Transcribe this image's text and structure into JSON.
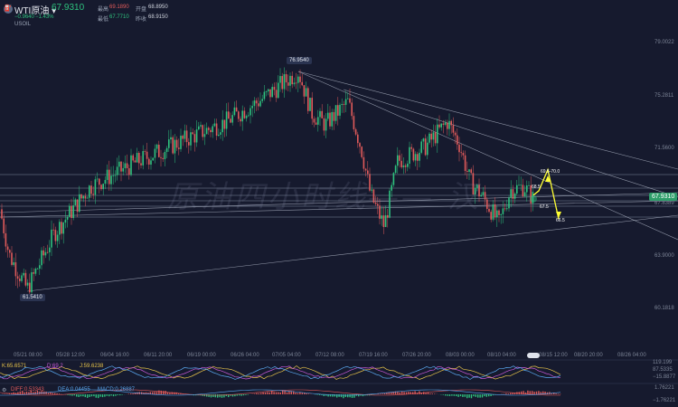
{
  "header": {
    "symbol": "WTI原油",
    "dropdown_glyph": "▾",
    "price": "67.9310",
    "change": "−0.9640",
    "change_pct": "−1.43%",
    "subtitle": "USOIL",
    "quotes": [
      {
        "label": "最高",
        "value": "69.1890",
        "color": "#e05a5a"
      },
      {
        "label": "开盘",
        "value": "68.8950",
        "color": "#cfd3dc"
      },
      {
        "label": "最低",
        "value": "67.7710",
        "color": "#2ec27e"
      },
      {
        "label": "昨收",
        "value": "68.9150",
        "color": "#cfd3dc"
      }
    ],
    "icon": "oil-icon"
  },
  "y_axis": [
    "79.0022",
    "75.2811",
    "71.5600",
    "67.8389",
    "63.9000",
    "60.1818"
  ],
  "x_axis": [
    "05/21 08:00",
    "05/28 12:00",
    "06/04 16:00",
    "06/11 20:00",
    "06/19 00:00",
    "06/26 04:00",
    "07/05 04:00",
    "07/12 08:00",
    "07/19 16:00",
    "07/26 20:00",
    "08/03 00:00",
    "08/10 04:00",
    "08/15 12:00",
    "08/20 20:00",
    "08/26 04:00"
  ],
  "price_labels": {
    "high": "76.9540",
    "low": "61.5410",
    "current": "67.9310"
  },
  "annotations": [
    "69.5-70.0",
    "68.5",
    "67.5",
    "66.5"
  ],
  "watermark": "原油四小时线——",
  "watermark_tail": "汉",
  "indicators": {
    "kdj": {
      "k": "K:65.6571",
      "d": "D:69.2",
      "j": "J:59.6238"
    },
    "kdj_ticks": [
      "119.199",
      "87.5335",
      "−15.8877"
    ],
    "macd": {
      "diff": "DIFF:0.53343",
      "dea": "DEA:0.04455",
      "macd": "MACD:0.26887"
    },
    "macd_ticks": [
      "1.76221",
      "−1.76221"
    ]
  },
  "colors": {
    "up": "#2ec27e",
    "down": "#e05a5a",
    "bg": "#161a2e",
    "annotation": "#ffff33"
  },
  "chart_data": {
    "type": "candlestick",
    "x": [
      "05/21 08:00",
      "05/28 12:00",
      "06/04 16:00",
      "06/11 20:00",
      "06/19 00:00",
      "06/26 04:00",
      "07/05 04:00",
      "07/12 08:00",
      "07/19 16:00",
      "07/26 20:00",
      "08/03 00:00",
      "08/10 04:00",
      "08/15 12:00",
      "08/20 20:00",
      "08/26 04:00"
    ],
    "path": [
      [
        0,
        67.2
      ],
      [
        10,
        64.0
      ],
      [
        30,
        61.54
      ],
      [
        60,
        65.5
      ],
      [
        100,
        68.8
      ],
      [
        150,
        70.5
      ],
      [
        200,
        72.0
      ],
      [
        250,
        73.4
      ],
      [
        290,
        75.0
      ],
      [
        330,
        76.954
      ],
      [
        345,
        74.0
      ],
      [
        360,
        73.2
      ],
      [
        385,
        74.8
      ],
      [
        400,
        71.4
      ],
      [
        410,
        68.2
      ],
      [
        425,
        66.0
      ],
      [
        440,
        70.6
      ],
      [
        470,
        71.6
      ],
      [
        495,
        73.4
      ],
      [
        508,
        71.8
      ],
      [
        520,
        69.2
      ],
      [
        535,
        68.0
      ],
      [
        552,
        66.2
      ],
      [
        565,
        68.6
      ],
      [
        580,
        68.8
      ],
      [
        590,
        67.93
      ]
    ],
    "high": 76.954,
    "low": 61.541,
    "last": 67.931,
    "y_ticks": [
      79.0022,
      75.2811,
      71.56,
      67.8389,
      63.9,
      60.1818
    ],
    "support_resistance": [
      69.5,
      70.0,
      68.5,
      67.5,
      66.5
    ],
    "forecast_path": [
      [
        596,
        68.5
      ],
      [
        606,
        70.0
      ],
      [
        618,
        66.5
      ]
    ]
  }
}
